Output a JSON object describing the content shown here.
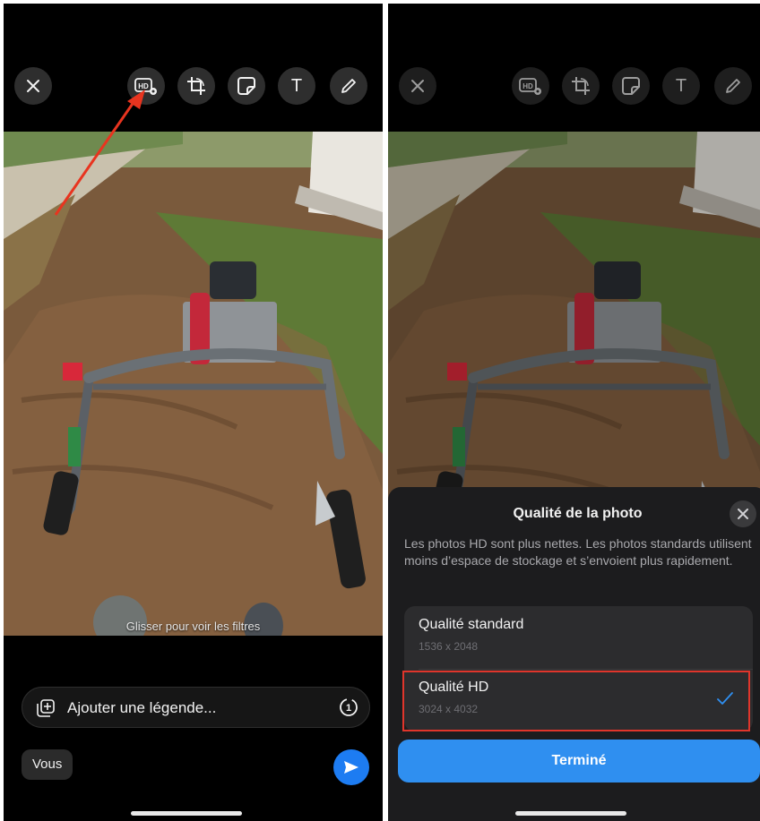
{
  "left_screen": {
    "toolbar": {
      "icons": [
        "close-icon",
        "hd-quality-icon",
        "crop-icon",
        "sticker-icon",
        "text-icon",
        "draw-icon"
      ],
      "text_tool_label": "T"
    },
    "annotation": {
      "arrow_color": "#e8341f"
    },
    "photo_hint": "Glisser pour voir les filtres",
    "caption": {
      "placeholder": "Ajouter une légende...",
      "view_once_label": "1"
    },
    "recipient_chip": "Vous",
    "send_button_color": "#1d7cf2"
  },
  "right_screen": {
    "toolbar": {
      "icons": [
        "close-icon",
        "hd-quality-icon",
        "crop-icon",
        "sticker-icon",
        "text-icon",
        "draw-icon"
      ],
      "text_tool_label": "T"
    },
    "sheet": {
      "title": "Qualité de la photo",
      "description": "Les photos HD sont plus nettes. Les photos standards utilisent moins d’espace de stockage et s’envoient plus rapidement.",
      "options": [
        {
          "label": "Qualité standard",
          "resolution": "1536 x 2048",
          "selected": false
        },
        {
          "label": "Qualité HD",
          "resolution": "3024 x 4032",
          "selected": true
        }
      ],
      "highlight_color": "#e0352b",
      "done_label": "Terminé",
      "accent_color": "#2f8ff0"
    }
  }
}
